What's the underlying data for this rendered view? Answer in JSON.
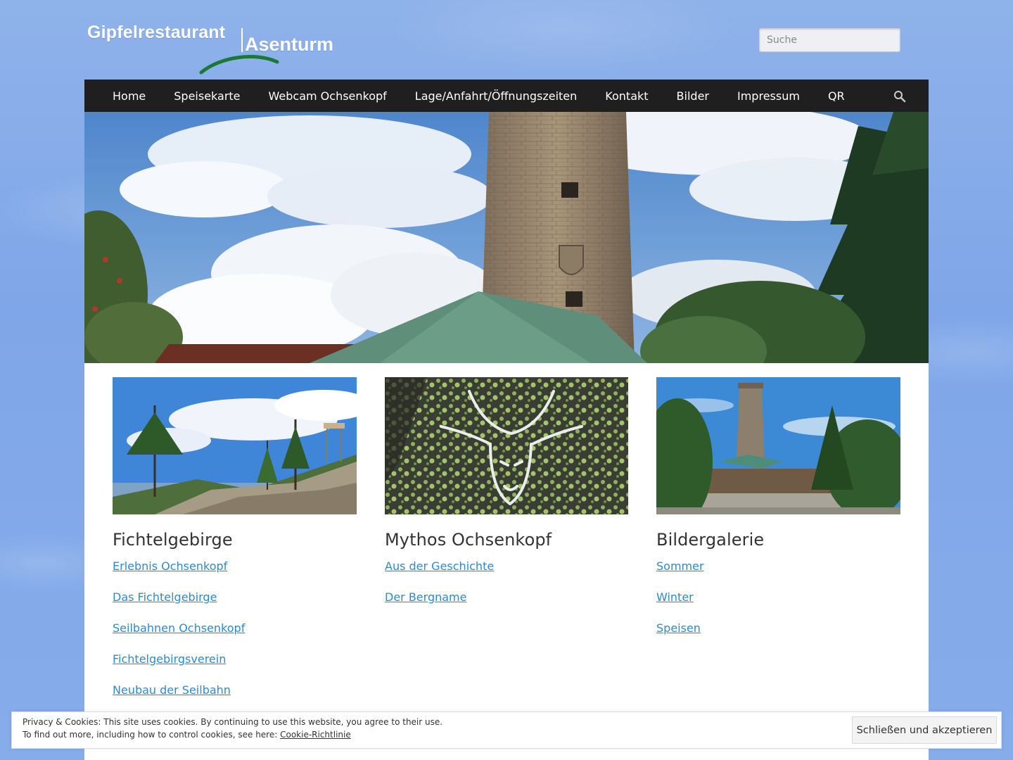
{
  "site": {
    "logo_line1": "Gipfelrestaurant",
    "logo_line2": "Asenturm",
    "brand_green": "#1f7a3a"
  },
  "search": {
    "placeholder": "Suche"
  },
  "nav": {
    "items": [
      {
        "label": "Home"
      },
      {
        "label": "Speisekarte"
      },
      {
        "label": "Webcam Ochsenkopf"
      },
      {
        "label": "Lage/Anfahrt/Öffnungszeiten"
      },
      {
        "label": "Kontakt"
      },
      {
        "label": "Bilder"
      },
      {
        "label": "Impressum"
      },
      {
        "label": "QR"
      }
    ],
    "search_icon": "search-icon"
  },
  "columns": [
    {
      "title": "Fichtelgebirge",
      "image": "rocky-forest-landscape",
      "links": [
        "Erlebnis Ochsenkopf",
        "Das Fichtelgebirge",
        "Seilbahnen Ochsenkopf",
        "Fichtelgebirgsverein",
        "Neubau der Seilbahn "
      ]
    },
    {
      "title": "Mythos Ochsenkopf",
      "image": "ox-head-rock-carving",
      "links": [
        "Aus der Geschichte",
        "Der Bergname"
      ]
    },
    {
      "title": "Bildergalerie",
      "image": "asenturm-tower-restaurant",
      "links": [
        "Sommer",
        "Winter",
        "Speisen"
      ]
    }
  ],
  "cookie": {
    "line1": "Privacy & Cookies: This site uses cookies. By continuing to use this website, you agree to their use.",
    "line2_prefix": "To find out more, including how to control cookies, see here: ",
    "policy_link": "Cookie-Richtlinie",
    "accept_label": "Schließen und akzeptieren"
  },
  "colors": {
    "link": "#2a8bd4",
    "navbar": "#1f1f1f",
    "background_sky": "#86acea"
  }
}
